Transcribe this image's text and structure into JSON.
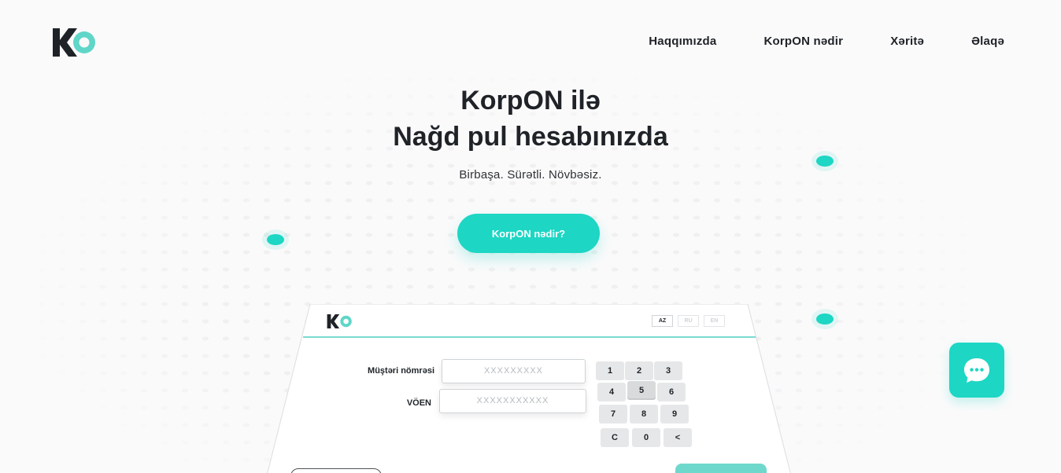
{
  "colors": {
    "accent": "#1dd6c4",
    "text": "#1f2328",
    "background": "#fbfafb"
  },
  "header": {
    "logo_text": "KO",
    "nav": [
      {
        "label": "Haqqımızda"
      },
      {
        "label": "KorpON nədir"
      },
      {
        "label": "Xəritə"
      },
      {
        "label": "Əlaqə"
      }
    ]
  },
  "hero": {
    "title_line1": "KorpON ilə",
    "title_line2": "Nağd pul hesabınızda",
    "subtitle": "Birbaşa. Sürətli. Növbəsiz.",
    "cta_label": "KorpON nədir?"
  },
  "kiosk": {
    "logo_text": "KO",
    "languages": [
      "AZ",
      "RU",
      "EN"
    ],
    "active_language": "AZ",
    "customer_label": "Müştəri nömrəsi",
    "customer_placeholder": "XXXXXXXXX",
    "voen_label": "VÖEN",
    "voen_placeholder": "XXXXXXXXXXX",
    "keypad": [
      "1",
      "2",
      "3",
      "4",
      "5",
      "6",
      "7",
      "8",
      "9",
      "C",
      "0",
      "<"
    ]
  },
  "chat": {
    "icon": "chat-bubble-icon"
  }
}
